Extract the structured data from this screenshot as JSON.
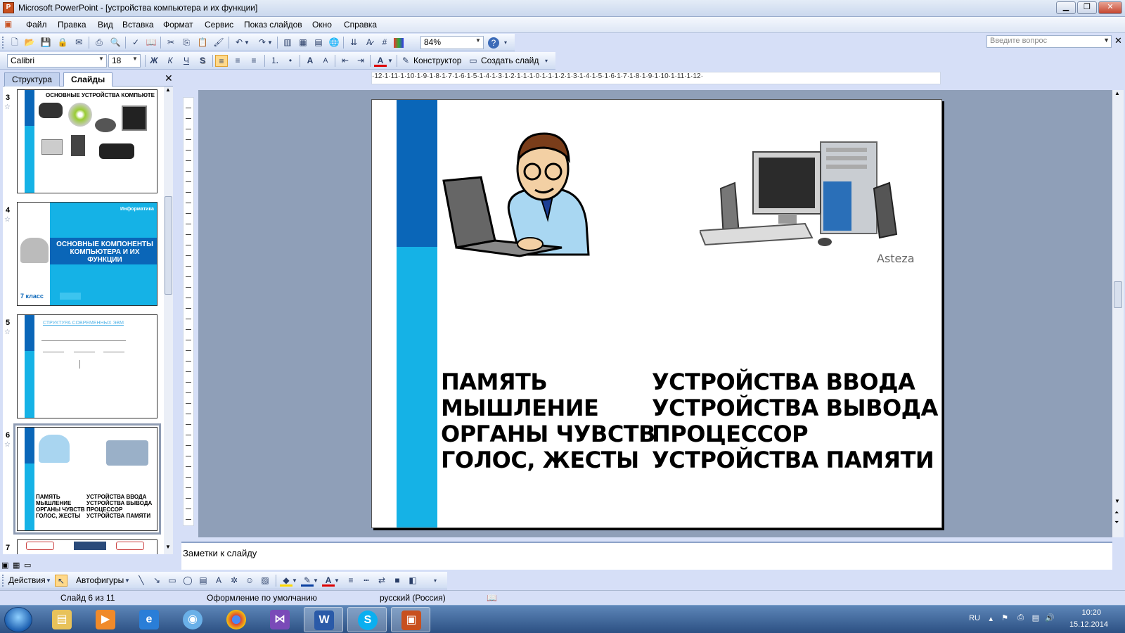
{
  "window": {
    "title": "Microsoft PowerPoint - [устройства компьютера и их функции]",
    "minimize": "▁",
    "restore": "❐",
    "close": "✕"
  },
  "menu": [
    "Файл",
    "Правка",
    "Вид",
    "Вставка",
    "Формат",
    "Сервис",
    "Показ слайдов",
    "Окно",
    "Справка"
  ],
  "help_placeholder": "Введите вопрос",
  "toolbar": {
    "zoom": "84%",
    "font": "Calibri",
    "size": "18",
    "designer": "Конструктор",
    "new_slide": "Создать слайд",
    "bold": "Ж",
    "italic": "К",
    "underline": "Ч",
    "shadow": "S"
  },
  "panel_tabs": {
    "outline": "Структура",
    "slides": "Слайды"
  },
  "thumbnails": [
    {
      "num": "3",
      "title": "ОСНОВНЫЕ УСТРОЙСТВА КОМПЬЮТЕ"
    },
    {
      "num": "4",
      "title": "ОСНОВНЫЕ КОМПОНЕНТЫ КОМПЬЮТЕРА И ИХ ФУНКЦИИ",
      "tag": "Информатика",
      "grade": "7 класс"
    },
    {
      "num": "5",
      "title": "СТРУКТУРА СОВРЕМЕННЫХ ЭВМ"
    },
    {
      "num": "6",
      "left": "ПАМЯТЬ\nМЫШЛЕНИЕ\nОРГАНЫ ЧУВСТВ\nГОЛОС, ЖЕСТЫ",
      "right": "УСТРОЙСТВА ВВОДА\nУСТРОЙСТВА ВЫВОДА\nПРОЦЕССОР\nУСТРОЙСТВА ПАМЯТИ"
    },
    {
      "num": "7"
    }
  ],
  "ruler_h": "·12·1·11·1·10·1·9·1·8·1·7·1·6·1·5·1·4·1·3·1·2·1·1·1·0·1·1·1·2·1·3·1·4·1·5·1·6·1·7·1·8·1·9·1·10·1·11·1·12·",
  "slide": {
    "left_col": [
      "ПАМЯТЬ",
      "МЫШЛЕНИЕ",
      "ОРГАНЫ ЧУВСТВ",
      "ГОЛОС, ЖЕСТЫ"
    ],
    "right_col": [
      "УСТРОЙСТВА ВВОДА",
      "УСТРОЙСТВА ВЫВОДА",
      "ПРОЦЕССОР",
      "УСТРОЙСТВА ПАМЯТИ"
    ],
    "watermark": "Asteza"
  },
  "notes_placeholder": "Заметки к слайду",
  "draw_toolbar": {
    "actions": "Действия",
    "autoshapes": "Автофигуры"
  },
  "status": {
    "slide": "Слайд 6 из 11",
    "design": "Оформление по умолчанию",
    "language": "русский (Россия)"
  },
  "tray": {
    "lang": "RU",
    "time": "10:20",
    "date": "15.12.2014"
  },
  "colors": {
    "slide_bar_light": "#15b2e6",
    "slide_bar_dark": "#0a66b8"
  }
}
